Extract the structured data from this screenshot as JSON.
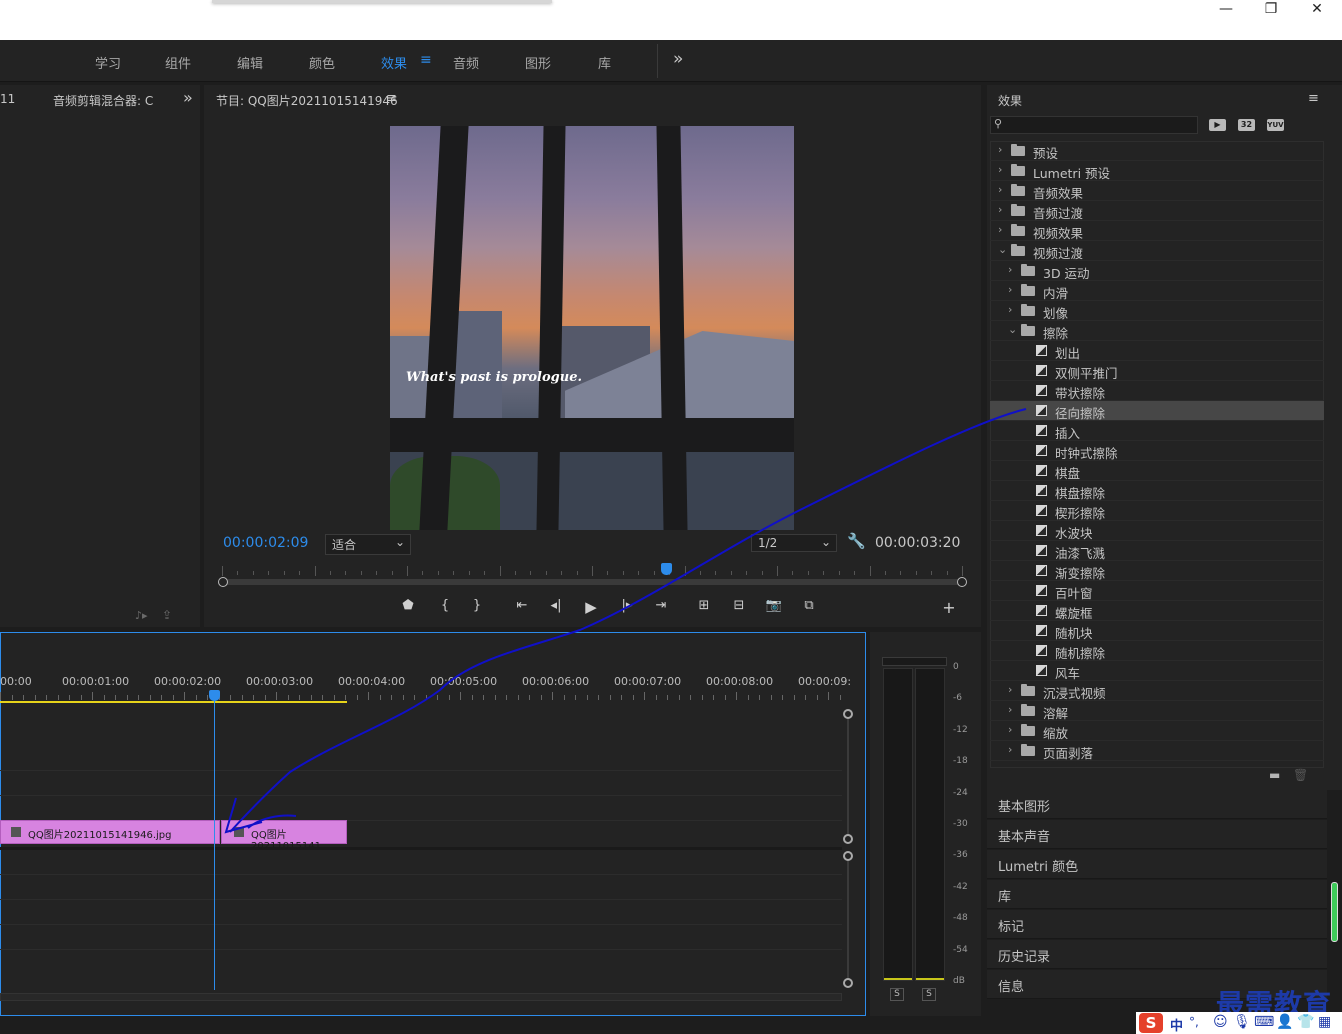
{
  "window": {
    "min_glyph": "—",
    "max_glyph": "❐",
    "close_glyph": "✕"
  },
  "workspaces": {
    "tabs": [
      "学习",
      "组件",
      "编辑",
      "颜色",
      "效果",
      "音频",
      "图形",
      "库"
    ],
    "active": "效果",
    "overflow_glyph": "»"
  },
  "left_panel": {
    "cut_label": "11",
    "title": "音频剪辑混合器: C",
    "overflow_glyph": "»"
  },
  "monitor": {
    "title": "节目: QQ图片20211015141946",
    "caption": "What's past is prologue.",
    "current_time": "00:00:02:09",
    "fit_label": "适合",
    "quality_label": "1/2",
    "duration": "00:00:03:20",
    "playhead_fraction": 0.6
  },
  "effects": {
    "title": "效果",
    "search_placeholder": "",
    "badge_32": "32",
    "badge_yuv": "YUV",
    "tree": [
      {
        "level": 0,
        "type": "folder",
        "expanded": false,
        "label": "预设",
        "star": true
      },
      {
        "level": 0,
        "type": "folder",
        "expanded": false,
        "label": "Lumetri 预设",
        "star": true
      },
      {
        "level": 0,
        "type": "folder",
        "expanded": false,
        "label": "音频效果"
      },
      {
        "level": 0,
        "type": "folder",
        "expanded": false,
        "label": "音频过渡"
      },
      {
        "level": 0,
        "type": "folder",
        "expanded": false,
        "label": "视频效果"
      },
      {
        "level": 0,
        "type": "folder",
        "expanded": true,
        "label": "视频过渡"
      },
      {
        "level": 1,
        "type": "folder",
        "expanded": false,
        "label": "3D 运动"
      },
      {
        "level": 1,
        "type": "folder",
        "expanded": false,
        "label": "内滑"
      },
      {
        "level": 1,
        "type": "folder",
        "expanded": false,
        "label": "划像"
      },
      {
        "level": 1,
        "type": "folder",
        "expanded": true,
        "label": "擦除"
      },
      {
        "level": 2,
        "type": "effect",
        "label": "划出"
      },
      {
        "level": 2,
        "type": "effect",
        "label": "双侧平推门"
      },
      {
        "level": 2,
        "type": "effect",
        "label": "带状擦除"
      },
      {
        "level": 2,
        "type": "effect",
        "label": "径向擦除",
        "selected": true
      },
      {
        "level": 2,
        "type": "effect",
        "label": "插入"
      },
      {
        "level": 2,
        "type": "effect",
        "label": "时钟式擦除"
      },
      {
        "level": 2,
        "type": "effect",
        "label": "棋盘"
      },
      {
        "level": 2,
        "type": "effect",
        "label": "棋盘擦除"
      },
      {
        "level": 2,
        "type": "effect",
        "label": "楔形擦除"
      },
      {
        "level": 2,
        "type": "effect",
        "label": "水波块"
      },
      {
        "level": 2,
        "type": "effect",
        "label": "油漆飞溅"
      },
      {
        "level": 2,
        "type": "effect",
        "label": "渐变擦除"
      },
      {
        "level": 2,
        "type": "effect",
        "label": "百叶窗"
      },
      {
        "level": 2,
        "type": "effect",
        "label": "螺旋框"
      },
      {
        "level": 2,
        "type": "effect",
        "label": "随机块"
      },
      {
        "level": 2,
        "type": "effect",
        "label": "随机擦除"
      },
      {
        "level": 2,
        "type": "effect",
        "label": "风车"
      },
      {
        "level": 1,
        "type": "folder",
        "expanded": false,
        "label": "沉浸式视频"
      },
      {
        "level": 1,
        "type": "folder",
        "expanded": false,
        "label": "溶解"
      },
      {
        "level": 1,
        "type": "folder",
        "expanded": false,
        "label": "缩放"
      },
      {
        "level": 1,
        "type": "folder",
        "expanded": false,
        "label": "页面剥落"
      }
    ]
  },
  "side_sections": [
    "基本图形",
    "基本声音",
    "Lumetri 颜色",
    "库",
    "标记",
    "历史记录",
    "信息"
  ],
  "timeline": {
    "ruler": [
      "00:00",
      "00:00:01:00",
      "00:00:02:00",
      "00:00:03:00",
      "00:00:04:00",
      "00:00:05:00",
      "00:00:06:00",
      "00:00:07:00",
      "00:00:08:00",
      "00:00:09:"
    ],
    "clip1": "QQ图片20211015141946.jpg",
    "clip2": "QQ图片20211015141"
  },
  "meter": {
    "db_labels": [
      "0",
      "-6",
      "-12",
      "-18",
      "-24",
      "-30",
      "-36",
      "-42",
      "-48",
      "-54",
      "dB"
    ],
    "solo_left": "S",
    "solo_right": "S"
  },
  "ime": {
    "lang": "中",
    "punct": "°,"
  },
  "watermark": "最需教育",
  "colors": {
    "accent": "#2d8ceb",
    "clip": "#d783e0",
    "annotation": "#1010c8"
  }
}
